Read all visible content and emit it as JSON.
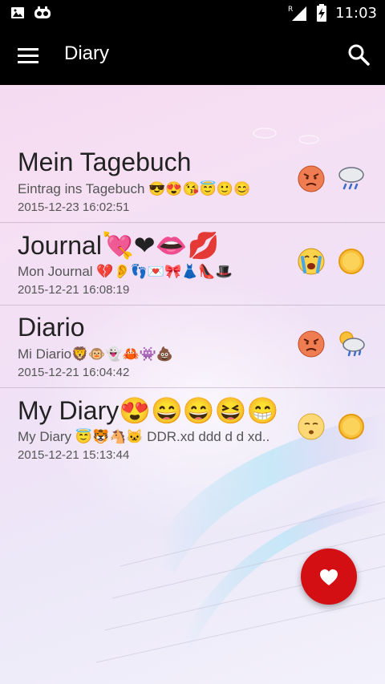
{
  "status": {
    "time": "11:03",
    "network_label": "R"
  },
  "app": {
    "title": "Diary"
  },
  "entries": [
    {
      "title": "Mein Tagebuch",
      "subtitle": "Eintrag ins Tagebuch 😎😍😘😇🙂😊",
      "date": "2015-12-23 16:02:51",
      "mood": "angry-face-icon",
      "weather": "rain-cloud-icon"
    },
    {
      "title": "Journal💘❤👄💋",
      "subtitle": "Mon Journal 💔👂👣💌🎀👗👠🎩",
      "date": "2015-12-21 16:08:19",
      "mood": "crying-face-icon",
      "weather": "sun-icon"
    },
    {
      "title": "Diario",
      "subtitle": "Mi Diario🦁🐵👻🦀👾💩",
      "date": "2015-12-21 16:04:42",
      "mood": "angry-face-icon",
      "weather": "cloud-rain-sun-icon"
    },
    {
      "title": "My Diary😍😄😄😆😁",
      "subtitle": "My Diary 😇🐯🐴🐱 DDR.xd ddd d d xd..",
      "date": "2015-12-21 15:13:44",
      "mood": "sleepy-face-icon",
      "weather": "sun-icon"
    }
  ],
  "colors": {
    "fab": "#d30f14",
    "bar": "#000000"
  }
}
